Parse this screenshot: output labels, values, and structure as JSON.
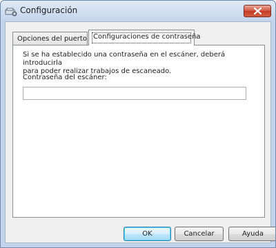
{
  "window": {
    "title": "Configuración",
    "app_icon": "scanner-settings-icon",
    "close_icon": "close-icon"
  },
  "tabs": [
    {
      "label": "Opciones del puerto",
      "selected": false
    },
    {
      "label": "Configuraciones de contraseña",
      "selected": true
    }
  ],
  "password_panel": {
    "description": "Si se ha establecido una contraseña en el escáner, deberá introducirla\npara poder realizar trabajos de escaneado.",
    "field_label": "Contraseña del escáner:",
    "field_value": ""
  },
  "buttons": {
    "ok_label": "OK",
    "cancel_label": "Cancelar",
    "help_label": "Ayuda"
  },
  "colors": {
    "close_button": "#c9452f",
    "default_button_border": "#3c7fb1"
  }
}
